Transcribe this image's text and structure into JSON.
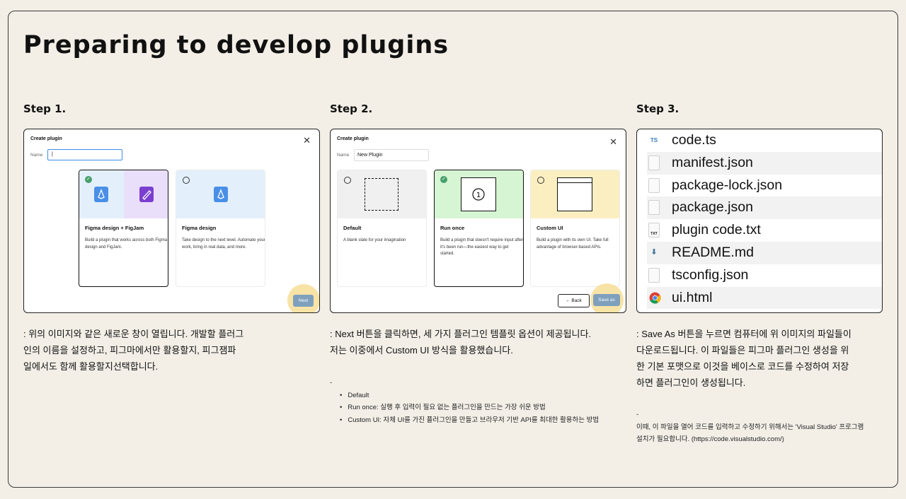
{
  "title": "Preparing to develop plugins",
  "steps": [
    {
      "label": "Step 1."
    },
    {
      "label": "Step 2."
    },
    {
      "label": "Step 3."
    }
  ],
  "step1": {
    "dialog_title": "Create plugin",
    "name_label": "Name",
    "name_value": "|",
    "cards": [
      {
        "title": "Figma design + FigJam",
        "desc": "Build a plugin that works across both Figma design and FigJam."
      },
      {
        "title": "Figma design",
        "desc": "Take design to the next level. Automate your work, bring in real data, and more."
      }
    ],
    "next_label": "Next",
    "text": ": 위의 이미지와 같은 새로운 창이 열립니다. 개발할 플러그인의 이름을 설정하고, 피그마에서만 활용할지, 피그잼파일에서도 함께 활용할지선택합니다.",
    "text_lines": [
      ": 위의 이미지와 같은 새로운 창이 열립니다. 개발할 플러그",
      "인의 이름을 설정하고, 피그마에서만 활용할지, 피그잼파",
      "일에서도 함께 활용할지선택합니다."
    ]
  },
  "step2": {
    "dialog_title": "Create plugin",
    "name_label": "Name",
    "name_value": "New Plugin",
    "cards": [
      {
        "title": "Default",
        "desc": "A blank slate for your imagination"
      },
      {
        "title": "Run once",
        "desc": "Build a plugin that doesn't require input after it's been run—the easiest way to get started."
      },
      {
        "title": "Custom UI",
        "desc": "Build a plugin with its own UI. Take full advantage of browser-based APIs."
      }
    ],
    "back_label": "Back",
    "save_label": "Save as",
    "text_lines": [
      ": Next 버튼을 클릭하면, 세 가지 플러그인 템플릿 옵션이 제공됩니다.",
      "저는 이중에서 Custom UI 방식을 활용했습니다."
    ],
    "note_dash": "-",
    "notes": [
      "Default",
      "Run once: 실행 후 입력이 필요 없는 플러그인을 만드는 가장 쉬운 방법",
      "Custom UI: 자체 UI를 가진 플러그인을 만들고 브라우저 기반 API를 최대한 활용하는 방법"
    ]
  },
  "step3": {
    "files": [
      {
        "name": "code.ts",
        "icon": "TS"
      },
      {
        "name": "manifest.json",
        "icon": ""
      },
      {
        "name": "package-lock.json",
        "icon": ""
      },
      {
        "name": "package.json",
        "icon": ""
      },
      {
        "name": "plugin code.txt",
        "icon": "TXT"
      },
      {
        "name": "README.md",
        "icon": ""
      },
      {
        "name": "tsconfig.json",
        "icon": ""
      },
      {
        "name": "ui.html",
        "icon": ""
      }
    ],
    "text_lines": [
      ": Save As 버튼을 누르면 컴퓨터에 위 이미지의 파일들이",
      "다운로드됩니다. 이 파일들은 피그마 플러그인 생성을 위",
      "한 기본 포맷으로 이것을 베이스로 코드를 수정하여 저장",
      "하면 플러그인이 생성됩니다."
    ],
    "note_dash": "-",
    "note_lines": [
      "이때, 이 파일을 열어 코드를 입력하고 수정하기 위해서는 'Visual Studio' 프로그램",
      "설치가 필요합니다. (https://code.visualstudio.com/)"
    ]
  },
  "colors": {
    "background": "#f3efe7",
    "highlight": "#f6d98a",
    "button_blue": "#7ea0bd",
    "check_green": "#46a06a"
  }
}
